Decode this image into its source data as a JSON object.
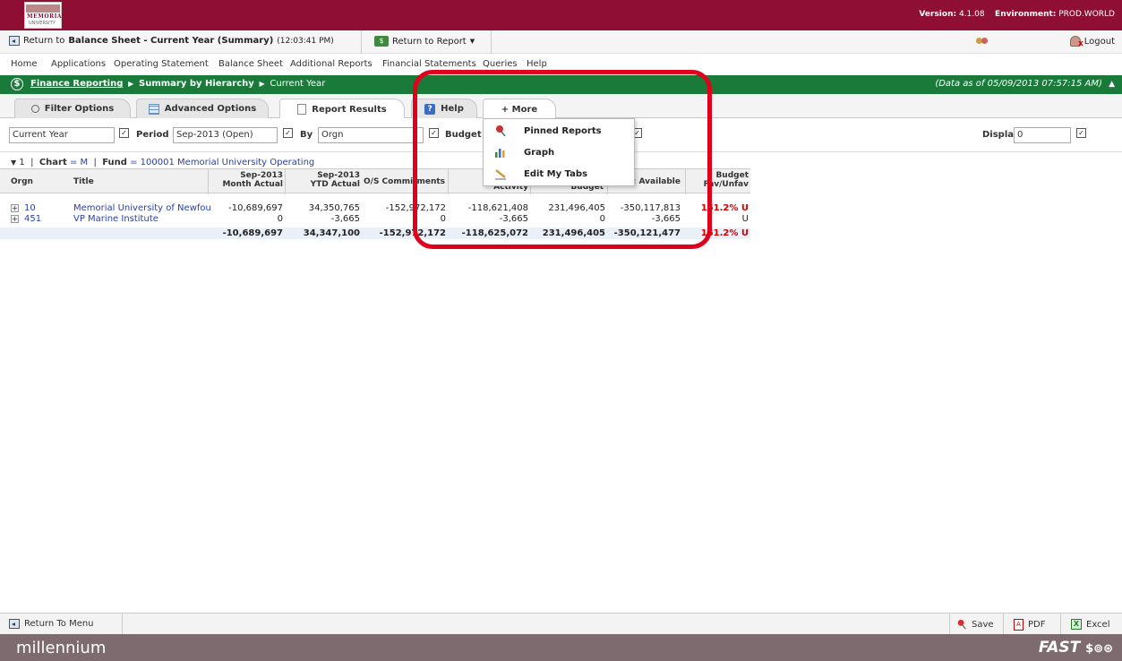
{
  "header": {
    "logo_text": "MEMORIAL",
    "logo_sub": "UNIVERSITY",
    "version_label": "Version:",
    "version_value": "4.1.08",
    "environment_label": "Environment:",
    "environment_value": "PROD.WORLD"
  },
  "returnbar": {
    "return_prefix": "Return to",
    "return_target": "Balance Sheet - Current Year (Summary)",
    "return_time": "(12:03:41 PM)",
    "return_report": "Return to Report",
    "logout": "Logout"
  },
  "menubar": {
    "items": [
      "Home",
      "Applications",
      "Operating Statement",
      "Balance Sheet",
      "Additional Reports",
      "Financial Statements",
      "Queries",
      "Help"
    ]
  },
  "nav": {
    "crumb1": "Finance Reporting",
    "crumb2": "Summary by Hierarchy",
    "crumb3": "Current Year",
    "asof": "(Data as of 05/09/2013 07:57:15 AM)"
  },
  "tabs": [
    {
      "label": "Filter Options",
      "icon": "search-icon"
    },
    {
      "label": "Advanced Options",
      "icon": "grid-icon"
    },
    {
      "label": "Report Results",
      "icon": "document-icon"
    },
    {
      "label": "Help",
      "icon": "help-icon"
    },
    {
      "label": "+ More",
      "icon": ""
    }
  ],
  "filters": {
    "year": "Current Year",
    "period_label": "Period",
    "period": "Sep-2013 (Open)",
    "by_label": "By",
    "by": "Orgn",
    "budget_label": "Budget",
    "display_label": "Display",
    "display": "0"
  },
  "report": {
    "level": "1",
    "chart_label": "Chart",
    "chart_value": "= M",
    "fund_label": "Fund",
    "fund_value": "= 100001 Memorial University Operating",
    "columns": {
      "orgn": "Orgn",
      "title": "Title",
      "month_actual_1": "Sep-2013",
      "month_actual_2": "Month Actual",
      "ytd_actual_1": "Sep-2013",
      "ytd_actual_2": "YTD Actual",
      "commitments": "O/S Commitments",
      "activity": "Activity",
      "budget": "Budget",
      "available": ": Available",
      "favunfav_1": "Budget",
      "favunfav_2": "Fav/Unfav"
    },
    "rows": [
      {
        "orgn": "10",
        "title": "Memorial University of Newfou",
        "month": "-10,689,697",
        "ytd": "34,350,765",
        "commit": "-152,972,172",
        "activity": "-118,621,408",
        "budget": "231,496,405",
        "available": "-350,117,813",
        "fav": "151.2% U"
      },
      {
        "orgn": "451",
        "title": "VP Marine Institute",
        "month": "0",
        "ytd": "-3,665",
        "commit": "0",
        "activity": "-3,665",
        "budget": "0",
        "available": "-3,665",
        "fav": "U"
      }
    ],
    "total": {
      "month": "-10,689,697",
      "ytd": "34,347,100",
      "commit": "-152,972,172",
      "activity": "-118,625,072",
      "budget": "231,496,405",
      "available": "-350,121,477",
      "fav": "151.2% U"
    }
  },
  "dropdown": {
    "items": [
      {
        "label": "Pinned Reports",
        "icon": "pin-icon"
      },
      {
        "label": "Graph",
        "icon": "bar-chart-icon"
      },
      {
        "label": "Edit My Tabs",
        "icon": "pencil-icon"
      }
    ]
  },
  "bottom": {
    "return_menu": "Return To Menu",
    "save": "Save",
    "pdf": "PDF",
    "excel": "Excel"
  },
  "footer": {
    "brand": "millennium",
    "fast": "FAST"
  },
  "colors": {
    "topbar": "#8e0e34",
    "navbar": "#1a7a3a",
    "highlight": "#e0001b",
    "footer": "#7d6b6f"
  }
}
